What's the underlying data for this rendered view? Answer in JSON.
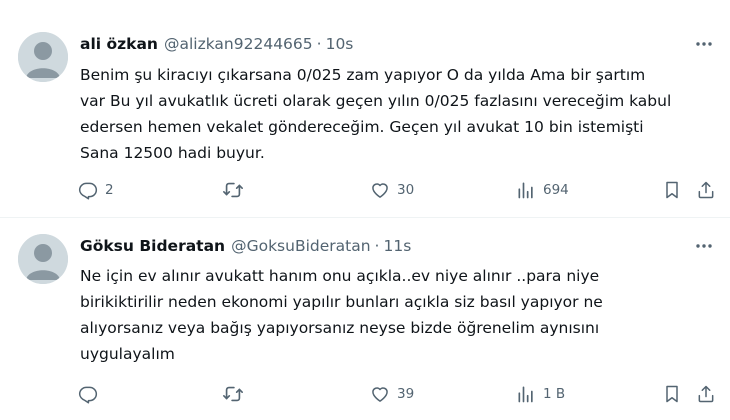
{
  "tweets": [
    {
      "name": "ali özkan",
      "handle": "@alizkan92244665",
      "separator": "·",
      "time": "10s",
      "text": "Benim şu kiracıyı  çıkarsana 0/025 zam yapıyor O da yılda Ama bir şartım\nvar Bu yıl avukatlık ücreti olarak geçen yılın 0/025 fazlasını vereceğim kabul\nedersen hemen vekalet göndereceğim. Geçen yıl avukat 10 bin istemişti\nSana 12500 hadi buyur.",
      "replies": "2",
      "retweets": "",
      "likes": "30",
      "views": "694"
    },
    {
      "name": "Göksu Bideratan",
      "handle": "@GoksuBideratan",
      "separator": "·",
      "time": "11s",
      "text": "Ne için ev alınır avukatt hanım onu açıkla..ev niye alınır ..para niye\nbirikiktirilir neden ekonomi yapılır bunları açıkla siz basıl yapıyor ne\nalıyorsanız veya bağış yapıyorsanız neyse bizde öğrenelim aynısını\nuygulayalım",
      "replies": "",
      "retweets": "",
      "likes": "39",
      "views": "1 B"
    }
  ],
  "icons": {
    "reply": "reply-icon",
    "retweet": "retweet-icon",
    "like": "like-icon",
    "views": "views-icon",
    "bookmark": "bookmark-icon",
    "share": "share-icon",
    "more": "more-icon",
    "avatar": "default-avatar"
  },
  "colors": {
    "text": "#0f1419",
    "secondary": "#536471",
    "divider": "#eff3f4",
    "avatar_bg": "#cfd9de"
  }
}
